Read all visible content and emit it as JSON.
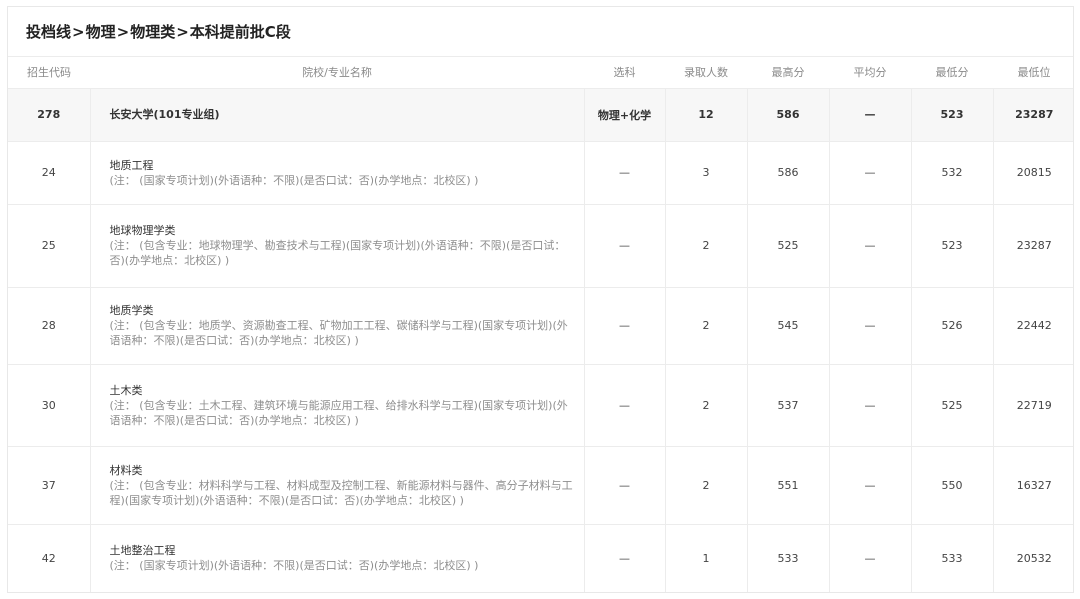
{
  "breadcrumb": [
    "投档线",
    "物理",
    "物理类",
    "本科提前批C段"
  ],
  "breadcrumb_separator": ">",
  "columns": [
    "招生代码",
    "院校/专业名称",
    "选科",
    "录取人数",
    "最高分",
    "平均分",
    "最低分",
    "最低位"
  ],
  "group": {
    "code": "278",
    "name": "长安大学(101专业组)",
    "subject": "物理+化学",
    "count": "12",
    "max": "586",
    "avg": "—",
    "min": "523",
    "rank": "23287"
  },
  "rows": [
    {
      "code": "24",
      "title": "地质工程",
      "note": "(注： (国家专项计划)(外语语种：不限)(是否口试：否)(办学地点：北校区) )",
      "subject": "—",
      "count": "3",
      "max": "586",
      "avg": "—",
      "min": "532",
      "rank": "20815"
    },
    {
      "code": "25",
      "title": "地球物理学类",
      "note": "(注： (包含专业：地球物理学、勘查技术与工程)(国家专项计划)(外语语种：不限)(是否口试：否)(办学地点：北校区) )",
      "subject": "—",
      "count": "2",
      "max": "525",
      "avg": "—",
      "min": "523",
      "rank": "23287"
    },
    {
      "code": "28",
      "title": "地质学类",
      "note": "(注： (包含专业：地质学、资源勘查工程、矿物加工工程、碳储科学与工程)(国家专项计划)(外语语种：不限)(是否口试：否)(办学地点：北校区) )",
      "subject": "—",
      "count": "2",
      "max": "545",
      "avg": "—",
      "min": "526",
      "rank": "22442"
    },
    {
      "code": "30",
      "title": "土木类",
      "note": "(注： (包含专业：土木工程、建筑环境与能源应用工程、给排水科学与工程)(国家专项计划)(外语语种：不限)(是否口试：否)(办学地点：北校区) )",
      "subject": "—",
      "count": "2",
      "max": "537",
      "avg": "—",
      "min": "525",
      "rank": "22719"
    },
    {
      "code": "37",
      "title": "材料类",
      "note": "(注： (包含专业：材料科学与工程、材料成型及控制工程、新能源材料与器件、高分子材料与工程)(国家专项计划)(外语语种：不限)(是否口试：否)(办学地点：北校区) )",
      "subject": "—",
      "count": "2",
      "max": "551",
      "avg": "—",
      "min": "550",
      "rank": "16327"
    },
    {
      "code": "42",
      "title": "土地整治工程",
      "note": "(注： (国家专项计划)(外语语种：不限)(是否口试：否)(办学地点：北校区) )",
      "subject": "—",
      "count": "1",
      "max": "533",
      "avg": "—",
      "min": "533",
      "rank": "20532"
    }
  ]
}
